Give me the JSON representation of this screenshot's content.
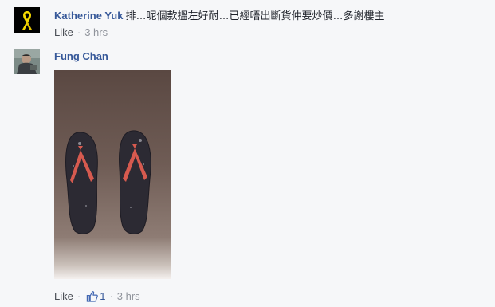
{
  "comments": [
    {
      "author": "Katherine Yuk",
      "text": "排…呢個款搵左好耐…已經唔出斷貨仲要炒價…多謝樓主",
      "like_label": "Like",
      "separator": "·",
      "time": "3 hrs",
      "avatar_icon": "yellow-ribbon-icon"
    },
    {
      "author": "Fung Chan",
      "like_label": "Like",
      "separator": "·",
      "like_count": "1",
      "time": "3 hrs",
      "avatar_icon": "person-photo",
      "attachment_icon": "flip-flops-photo"
    }
  ],
  "colors": {
    "author_link": "#365899",
    "body_text": "#1d2129",
    "meta_text": "#90949c",
    "background": "#f6f7f9",
    "thumb_blue": "#4267b2"
  }
}
